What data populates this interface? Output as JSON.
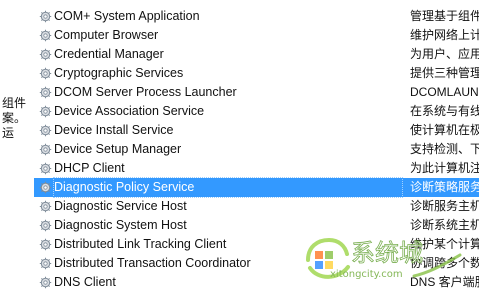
{
  "services_pane": {
    "description_text": "组件案。运",
    "rows": [
      {
        "name": "COM+ System Application",
        "desc": "管理基于组件"
      },
      {
        "name": "Computer Browser",
        "desc": "维护网络上计"
      },
      {
        "name": "Credential Manager",
        "desc": "为用户、应用"
      },
      {
        "name": "Cryptographic Services",
        "desc": "提供三种管理"
      },
      {
        "name": "DCOM Server Process Launcher",
        "desc": "DCOMLAUN"
      },
      {
        "name": "Device Association Service",
        "desc": "在系统与有线"
      },
      {
        "name": "Device Install Service",
        "desc": "使计算机在极"
      },
      {
        "name": "Device Setup Manager",
        "desc": "支持检测、下"
      },
      {
        "name": "DHCP Client",
        "desc": "为此计算机注"
      },
      {
        "name": "Diagnostic Policy Service",
        "desc": "诊断策略服务"
      },
      {
        "name": "Diagnostic Service Host",
        "desc": "诊断服务主机"
      },
      {
        "name": "Diagnostic System Host",
        "desc": "诊断系统主机"
      },
      {
        "name": "Distributed Link Tracking Client",
        "desc": "维护某个计算"
      },
      {
        "name": "Distributed Transaction Coordinator",
        "desc": "协调跨多个数"
      },
      {
        "name": "DNS Client",
        "desc": "DNS 客户端服"
      }
    ],
    "selected_index": 9
  },
  "watermark": {
    "logo_text": "系统城",
    "url_text": "xitongcity.com"
  },
  "colors": {
    "selection": "#3399ff",
    "icon_gear": "#7f8c99"
  },
  "icons": {
    "service_icon": "gear-icon"
  }
}
